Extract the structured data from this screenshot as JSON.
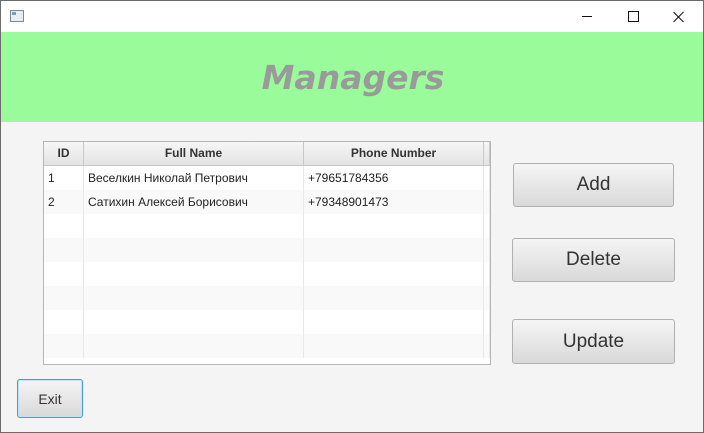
{
  "window": {
    "controls": {
      "minimize_icon": "minimize-icon",
      "maximize_icon": "maximize-icon",
      "close_icon": "close-icon"
    }
  },
  "header": {
    "title": "Managers",
    "background_color": "#9afb9a",
    "title_color": "#9a9a9a"
  },
  "table": {
    "columns": [
      "ID",
      "Full Name",
      "Phone Number"
    ],
    "rows": [
      {
        "id": "1",
        "full_name": "Веселкин Николай Петрович",
        "phone": "+79651784356"
      },
      {
        "id": "2",
        "full_name": "Сатихин Алексей Борисович",
        "phone": "+79348901473"
      }
    ]
  },
  "buttons": {
    "add": "Add",
    "delete": "Delete",
    "update": "Update",
    "exit": "Exit"
  }
}
